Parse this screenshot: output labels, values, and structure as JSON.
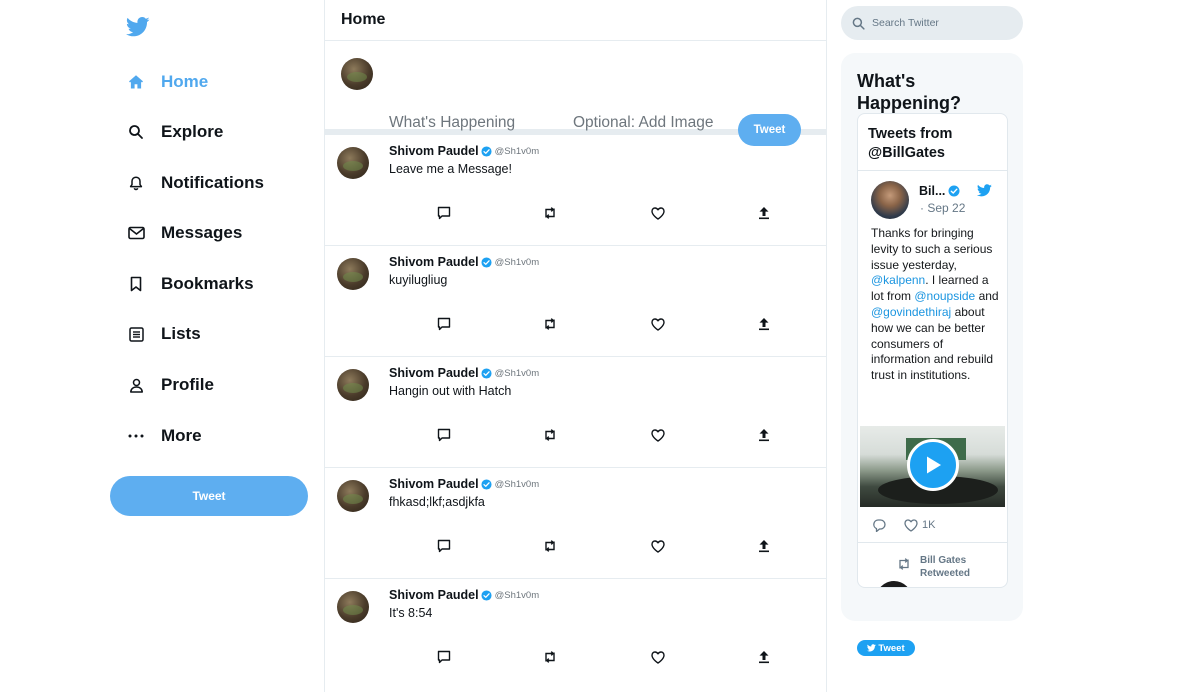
{
  "colors": {
    "accent": "#5eaef0",
    "active_nav": "#50a8ee",
    "verified": "#1da1f2",
    "mention": "#1b95e0"
  },
  "sidebar": {
    "logo_icon": "twitter-bird-icon",
    "items": [
      {
        "label": "Home",
        "icon": "home-icon"
      },
      {
        "label": "Explore",
        "icon": "search-icon"
      },
      {
        "label": "Notifications",
        "icon": "bell-icon"
      },
      {
        "label": "Messages",
        "icon": "mail-icon"
      },
      {
        "label": "Bookmarks",
        "icon": "bookmark-icon"
      },
      {
        "label": "Lists",
        "icon": "list-icon"
      },
      {
        "label": "Profile",
        "icon": "person-icon"
      },
      {
        "label": "More",
        "icon": "more-icon"
      }
    ],
    "tweet_button": "Tweet"
  },
  "main": {
    "title": "Home",
    "compose": {
      "placeholder": "What's Happening",
      "image_label": "Optional: Add Image",
      "tweet_button": "Tweet"
    },
    "posts": [
      {
        "name": "Shivom Paudel",
        "handle": "@Sh1v0m",
        "text": "Leave me a Message!"
      },
      {
        "name": "Shivom Paudel",
        "handle": "@Sh1v0m",
        "text": "kuyilugliug"
      },
      {
        "name": "Shivom Paudel",
        "handle": "@Sh1v0m",
        "text": "Hangin out with Hatch"
      },
      {
        "name": "Shivom Paudel",
        "handle": "@Sh1v0m",
        "text": "fhkasd;lkf;asdjkfa"
      },
      {
        "name": "Shivom Paudel",
        "handle": "@Sh1v0m",
        "text": "It's 8:54"
      }
    ]
  },
  "right": {
    "search_placeholder": "Search Twitter",
    "happening_title": "What's Happening?",
    "embed": {
      "title": "Tweets from @BillGates",
      "author_name": "Bil...",
      "date": "· Sep 22",
      "text_parts": [
        "Thanks for bringing levity to such a serious issue yesterday, ",
        "@kalpenn",
        ". I learned a lot from ",
        "@noupside",
        " and ",
        "@govindethiraj",
        " about how we can be better consumers of information and rebuild trust in institutions."
      ],
      "likes": "1K",
      "retweet_label_1": "Bill Gates",
      "retweet_label_2": "Retweeted",
      "tweet_button": "Tweet"
    }
  }
}
